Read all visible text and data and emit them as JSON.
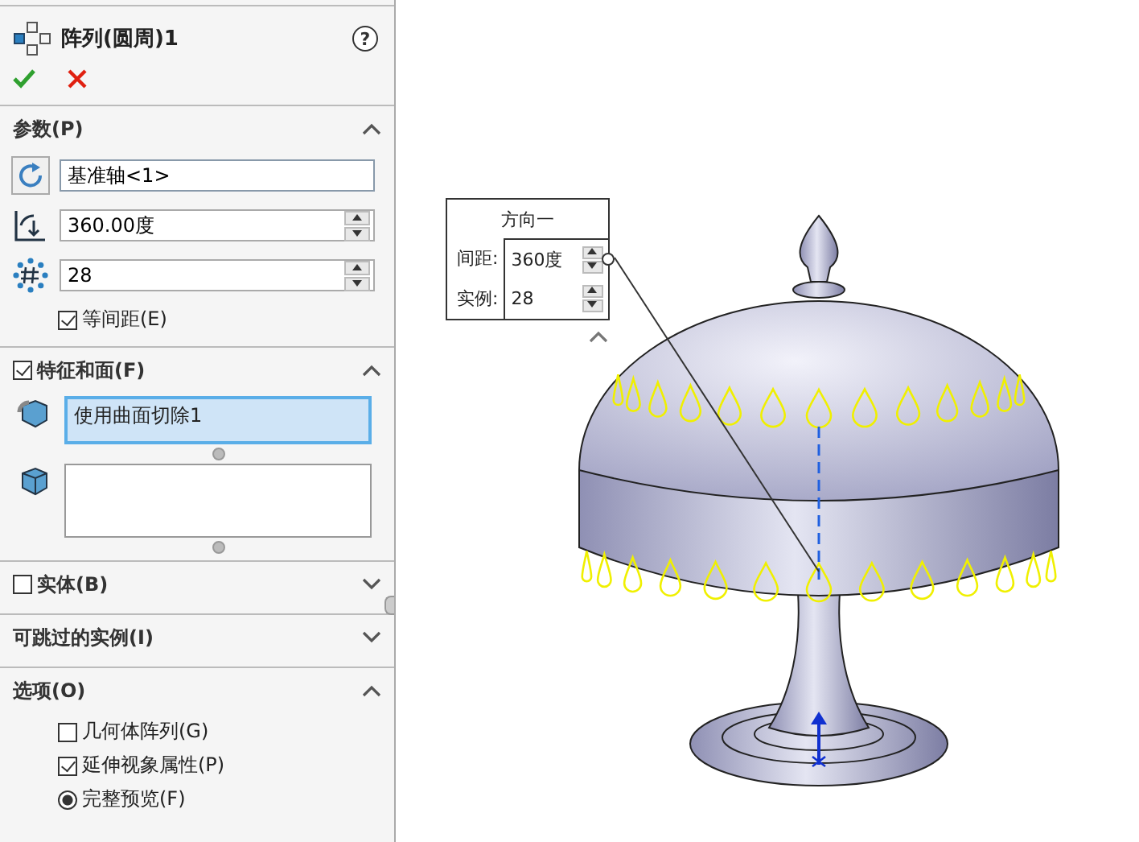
{
  "panel": {
    "title": "阵列(圆周)1",
    "help": "?"
  },
  "params": {
    "title": "参数(P)",
    "expanded": true,
    "axis": {
      "value": "基准轴<1>"
    },
    "angle": {
      "value": "360.00度"
    },
    "count": {
      "value": "28"
    },
    "equal_spacing": {
      "label": "等间距(E)",
      "checked": true
    }
  },
  "features": {
    "title": "特征和面(F)",
    "checked": true,
    "expanded": true,
    "features_list": {
      "active": true,
      "items": [
        "使用曲面切除1"
      ]
    },
    "faces_list": {
      "active": false
    }
  },
  "bodies": {
    "title": "实体(B)",
    "checked": false,
    "expanded": false
  },
  "skip": {
    "title": "可跳过的实例(I)",
    "expanded": false
  },
  "options": {
    "title": "选项(O)",
    "expanded": true,
    "items": [
      {
        "kind": "checkbox",
        "label": "几何体阵列(G)",
        "checked": false
      },
      {
        "kind": "checkbox",
        "label": "延伸视象属性(P)",
        "checked": true
      },
      {
        "kind": "radio",
        "label": "完整预览(F)",
        "selected": true
      }
    ]
  },
  "callout": {
    "title": "方向一",
    "rows": [
      {
        "label": "间距:",
        "value": "360度"
      },
      {
        "label": "实例:",
        "value": "28"
      }
    ]
  }
}
